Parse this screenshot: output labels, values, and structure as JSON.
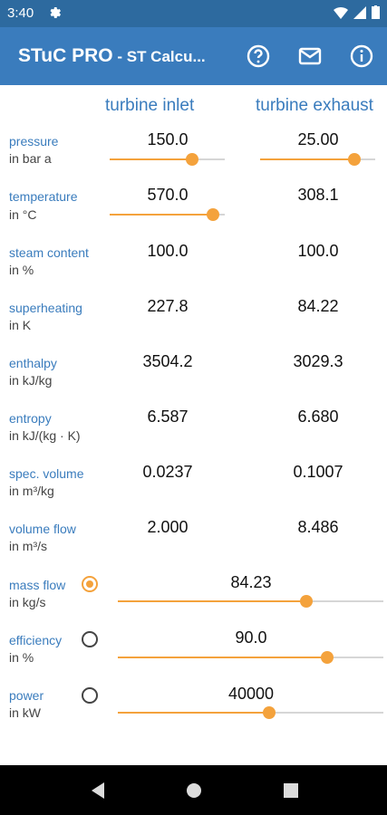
{
  "status": {
    "time": "3:40"
  },
  "app": {
    "title": "STuC PRO",
    "subtitle": " - ST Calcu..."
  },
  "columns": {
    "inlet": "turbine inlet",
    "exhaust": "turbine exhaust"
  },
  "rows": [
    {
      "label": "pressure",
      "unit": "in bar a",
      "inlet": "150.0",
      "exhaust": "25.00"
    },
    {
      "label": "temperature",
      "unit": "in °C",
      "inlet": "570.0",
      "exhaust": "308.1"
    },
    {
      "label": "steam content",
      "unit": "in %",
      "inlet": "100.0",
      "exhaust": "100.0"
    },
    {
      "label": "superheating",
      "unit": "in K",
      "inlet": "227.8",
      "exhaust": "84.22"
    },
    {
      "label": "enthalpy",
      "unit": "in kJ/kg",
      "inlet": "3504.2",
      "exhaust": "3029.3"
    },
    {
      "label": "entropy",
      "unit": "in kJ/(kg · K)",
      "inlet": "6.587",
      "exhaust": "6.680"
    },
    {
      "label": "spec. volume",
      "unit": "in m³/kg",
      "inlet": "0.0237",
      "exhaust": "0.1007"
    },
    {
      "label": "volume flow",
      "unit": "in m³/s",
      "inlet": "2.000",
      "exhaust": "8.486"
    }
  ],
  "bottom": [
    {
      "label": "mass flow",
      "unit": "in kg/s",
      "value": "84.23",
      "selected": true
    },
    {
      "label": "efficiency",
      "unit": "in %",
      "value": "90.0",
      "selected": false
    },
    {
      "label": "power",
      "unit": "in kW",
      "value": "40000",
      "selected": false
    }
  ],
  "sliders": {
    "pressure_inlet": 0.72,
    "pressure_exhaust": 0.82,
    "temperature_inlet": 0.9,
    "mass_flow": 0.71,
    "efficiency": 0.79,
    "power": 0.57
  },
  "colors": {
    "accent": "#f4a23c",
    "primary": "#3a7cbd",
    "status": "#2d6a9f"
  }
}
